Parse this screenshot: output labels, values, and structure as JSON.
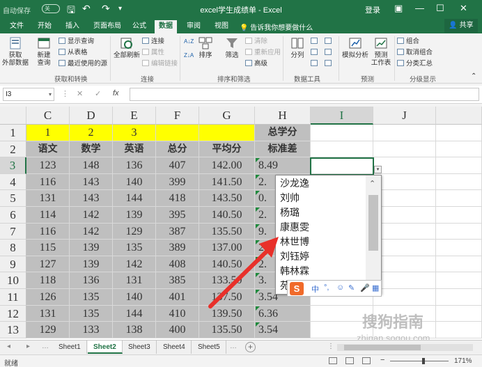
{
  "titlebar": {
    "autosave": "自动保存",
    "toggle": "关",
    "title": "excel学生成绩单 - Excel",
    "login": "登录"
  },
  "tabs": [
    "文件",
    "开始",
    "插入",
    "页面布局",
    "公式",
    "数据",
    "审阅",
    "视图"
  ],
  "active_tab": "数据",
  "tell_me": "告诉我你想要做什么",
  "share": "共享",
  "ribbon": {
    "get_external": "获取\n外部数据",
    "new_query": "新建\n查询",
    "show_query": "显示查询",
    "from_table": "从表格",
    "recent_sources": "最近使用的源",
    "group_get_transform": "获取和转换",
    "refresh_all": "全部刷新",
    "connections": "连接",
    "properties": "属性",
    "edit_links": "编辑链接",
    "group_connections": "连接",
    "sort_az": "A↓Z",
    "sort_za": "Z↓A",
    "sort": "排序",
    "filter": "筛选",
    "clear": "清除",
    "reapply": "重新应用",
    "advanced": "高级",
    "group_sort_filter": "排序和筛选",
    "text_to_columns": "分列",
    "group_data_tools": "数据工具",
    "what_if": "模拟分析",
    "forecast_sheet": "预测\n工作表",
    "group_forecast": "预测",
    "group": "组合",
    "ungroup": "取消组合",
    "subtotal": "分类汇总",
    "group_outline": "分级显示"
  },
  "namebox": "I3",
  "formula": "",
  "columns": [
    "C",
    "D",
    "E",
    "F",
    "G",
    "H",
    "I",
    "J"
  ],
  "selected_column": "I",
  "rows": [
    "1",
    "2",
    "3",
    "4",
    "5",
    "6",
    "7",
    "8",
    "9",
    "10",
    "11",
    "12",
    "13"
  ],
  "selected_row": "3",
  "row1": [
    "1",
    "2",
    "3",
    "",
    "",
    "总学分"
  ],
  "row2": [
    "语文",
    "数学",
    "英语",
    "总分",
    "平均分",
    "标准差"
  ],
  "data_rows": [
    [
      "123",
      "148",
      "136",
      "407",
      "142.00",
      "8.49"
    ],
    [
      "116",
      "143",
      "140",
      "399",
      "141.50",
      "2."
    ],
    [
      "131",
      "143",
      "144",
      "418",
      "143.50",
      "0."
    ],
    [
      "114",
      "142",
      "139",
      "395",
      "140.50",
      "2."
    ],
    [
      "116",
      "142",
      "129",
      "387",
      "135.50",
      "9."
    ],
    [
      "115",
      "139",
      "135",
      "389",
      "137.00",
      "2"
    ],
    [
      "127",
      "139",
      "142",
      "408",
      "140.50",
      "2."
    ],
    [
      "118",
      "136",
      "131",
      "385",
      "133.50",
      "3."
    ],
    [
      "126",
      "135",
      "140",
      "401",
      "137.50",
      "3.54"
    ],
    [
      "131",
      "135",
      "144",
      "410",
      "139.50",
      "6.36"
    ],
    [
      "129",
      "133",
      "138",
      "400",
      "135.50",
      "3.54"
    ]
  ],
  "dropdown_items": [
    "沙龙逸",
    "刘帅",
    "杨璐",
    "康惠雯",
    "林世博",
    "刘钰婷",
    "韩林霖",
    "苑"
  ],
  "ime_items": [
    "中",
    "°,",
    "☺",
    "✎",
    "🎤",
    "▦"
  ],
  "ime_logo": "S",
  "sheets": [
    "Sheet1",
    "Sheet2",
    "Sheet3",
    "Sheet4",
    "Sheet5"
  ],
  "active_sheet": "Sheet2",
  "status": {
    "ready": "就绪",
    "zoom": "171%"
  },
  "watermark": "搜狗指南",
  "watermark_url": "zhinan.sogou.com",
  "colors": {
    "excel_green": "#217346",
    "highlight_yellow": "#ffff00",
    "gray_fill": "#bfbfbf",
    "arrow_red": "#e8302a"
  }
}
